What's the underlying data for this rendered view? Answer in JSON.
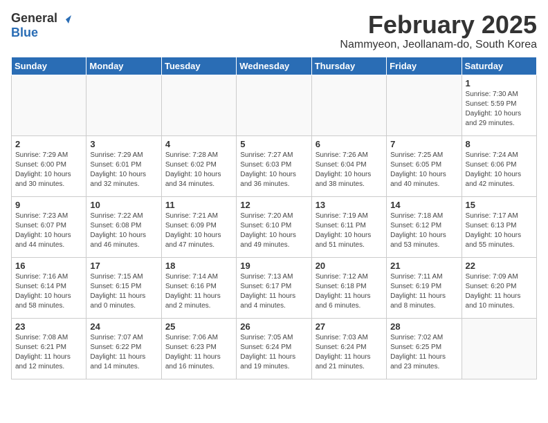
{
  "header": {
    "logo_general": "General",
    "logo_blue": "Blue",
    "month": "February 2025",
    "location": "Nammyeon, Jeollanam-do, South Korea"
  },
  "days_of_week": [
    "Sunday",
    "Monday",
    "Tuesday",
    "Wednesday",
    "Thursday",
    "Friday",
    "Saturday"
  ],
  "weeks": [
    [
      {
        "day": "",
        "info": ""
      },
      {
        "day": "",
        "info": ""
      },
      {
        "day": "",
        "info": ""
      },
      {
        "day": "",
        "info": ""
      },
      {
        "day": "",
        "info": ""
      },
      {
        "day": "",
        "info": ""
      },
      {
        "day": "1",
        "info": "Sunrise: 7:30 AM\nSunset: 5:59 PM\nDaylight: 10 hours and 29 minutes."
      }
    ],
    [
      {
        "day": "2",
        "info": "Sunrise: 7:29 AM\nSunset: 6:00 PM\nDaylight: 10 hours and 30 minutes."
      },
      {
        "day": "3",
        "info": "Sunrise: 7:29 AM\nSunset: 6:01 PM\nDaylight: 10 hours and 32 minutes."
      },
      {
        "day": "4",
        "info": "Sunrise: 7:28 AM\nSunset: 6:02 PM\nDaylight: 10 hours and 34 minutes."
      },
      {
        "day": "5",
        "info": "Sunrise: 7:27 AM\nSunset: 6:03 PM\nDaylight: 10 hours and 36 minutes."
      },
      {
        "day": "6",
        "info": "Sunrise: 7:26 AM\nSunset: 6:04 PM\nDaylight: 10 hours and 38 minutes."
      },
      {
        "day": "7",
        "info": "Sunrise: 7:25 AM\nSunset: 6:05 PM\nDaylight: 10 hours and 40 minutes."
      },
      {
        "day": "8",
        "info": "Sunrise: 7:24 AM\nSunset: 6:06 PM\nDaylight: 10 hours and 42 minutes."
      }
    ],
    [
      {
        "day": "9",
        "info": "Sunrise: 7:23 AM\nSunset: 6:07 PM\nDaylight: 10 hours and 44 minutes."
      },
      {
        "day": "10",
        "info": "Sunrise: 7:22 AM\nSunset: 6:08 PM\nDaylight: 10 hours and 46 minutes."
      },
      {
        "day": "11",
        "info": "Sunrise: 7:21 AM\nSunset: 6:09 PM\nDaylight: 10 hours and 47 minutes."
      },
      {
        "day": "12",
        "info": "Sunrise: 7:20 AM\nSunset: 6:10 PM\nDaylight: 10 hours and 49 minutes."
      },
      {
        "day": "13",
        "info": "Sunrise: 7:19 AM\nSunset: 6:11 PM\nDaylight: 10 hours and 51 minutes."
      },
      {
        "day": "14",
        "info": "Sunrise: 7:18 AM\nSunset: 6:12 PM\nDaylight: 10 hours and 53 minutes."
      },
      {
        "day": "15",
        "info": "Sunrise: 7:17 AM\nSunset: 6:13 PM\nDaylight: 10 hours and 55 minutes."
      }
    ],
    [
      {
        "day": "16",
        "info": "Sunrise: 7:16 AM\nSunset: 6:14 PM\nDaylight: 10 hours and 58 minutes."
      },
      {
        "day": "17",
        "info": "Sunrise: 7:15 AM\nSunset: 6:15 PM\nDaylight: 11 hours and 0 minutes."
      },
      {
        "day": "18",
        "info": "Sunrise: 7:14 AM\nSunset: 6:16 PM\nDaylight: 11 hours and 2 minutes."
      },
      {
        "day": "19",
        "info": "Sunrise: 7:13 AM\nSunset: 6:17 PM\nDaylight: 11 hours and 4 minutes."
      },
      {
        "day": "20",
        "info": "Sunrise: 7:12 AM\nSunset: 6:18 PM\nDaylight: 11 hours and 6 minutes."
      },
      {
        "day": "21",
        "info": "Sunrise: 7:11 AM\nSunset: 6:19 PM\nDaylight: 11 hours and 8 minutes."
      },
      {
        "day": "22",
        "info": "Sunrise: 7:09 AM\nSunset: 6:20 PM\nDaylight: 11 hours and 10 minutes."
      }
    ],
    [
      {
        "day": "23",
        "info": "Sunrise: 7:08 AM\nSunset: 6:21 PM\nDaylight: 11 hours and 12 minutes."
      },
      {
        "day": "24",
        "info": "Sunrise: 7:07 AM\nSunset: 6:22 PM\nDaylight: 11 hours and 14 minutes."
      },
      {
        "day": "25",
        "info": "Sunrise: 7:06 AM\nSunset: 6:23 PM\nDaylight: 11 hours and 16 minutes."
      },
      {
        "day": "26",
        "info": "Sunrise: 7:05 AM\nSunset: 6:24 PM\nDaylight: 11 hours and 19 minutes."
      },
      {
        "day": "27",
        "info": "Sunrise: 7:03 AM\nSunset: 6:24 PM\nDaylight: 11 hours and 21 minutes."
      },
      {
        "day": "28",
        "info": "Sunrise: 7:02 AM\nSunset: 6:25 PM\nDaylight: 11 hours and 23 minutes."
      },
      {
        "day": "",
        "info": ""
      }
    ]
  ]
}
